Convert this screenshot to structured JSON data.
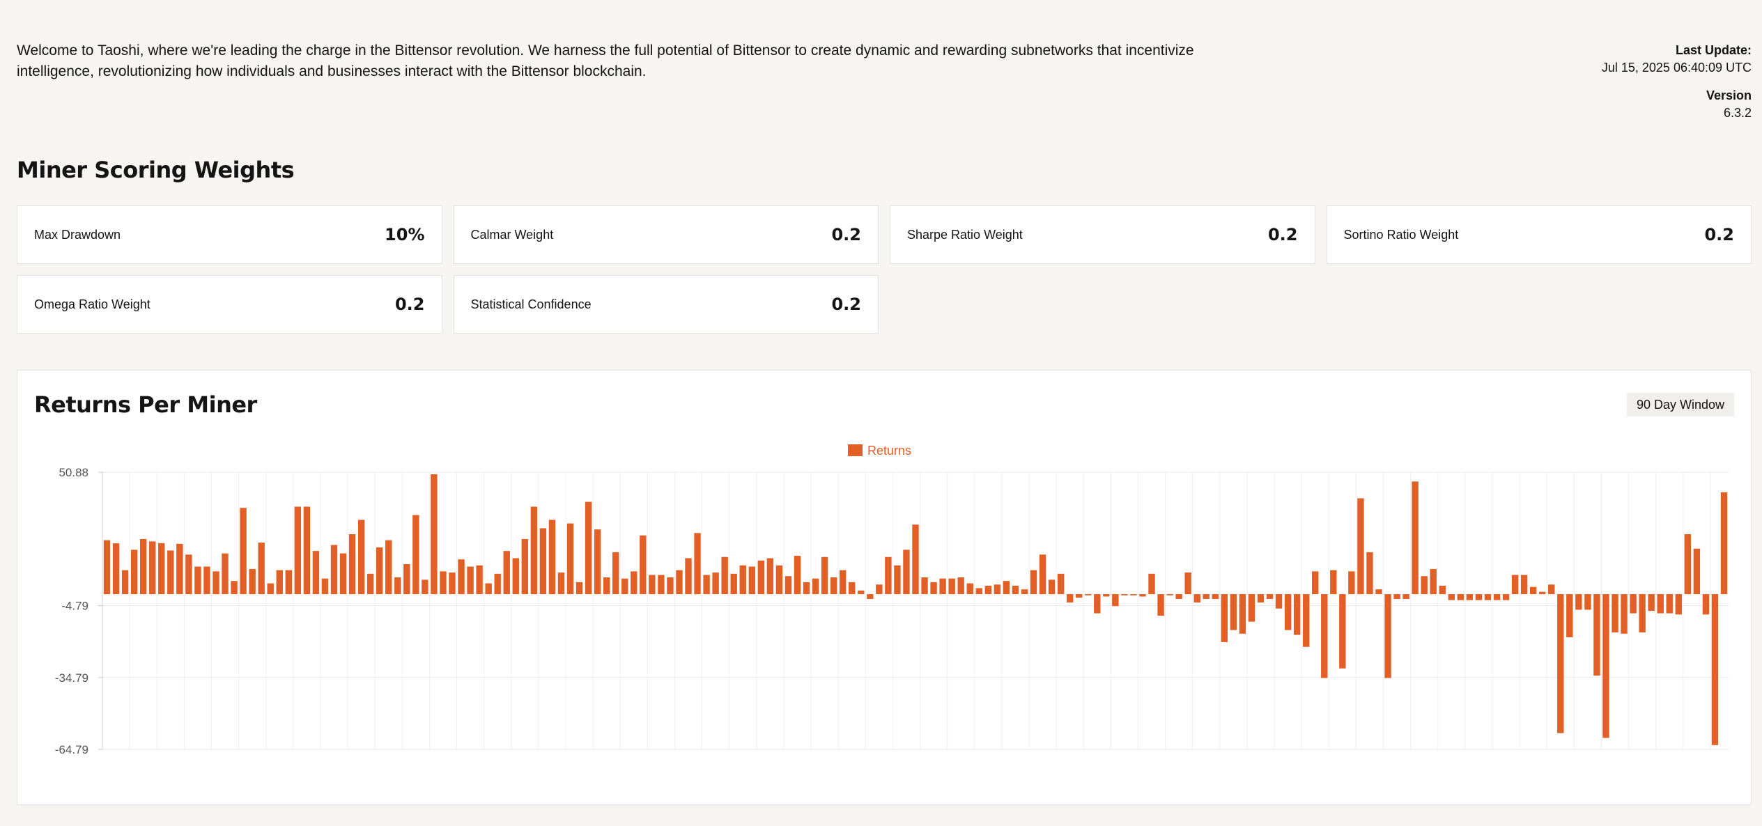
{
  "intro": "Welcome to Taoshi, where we're leading the charge in the Bittensor revolution. We harness the full potential of Bittensor to create dynamic and rewarding subnetworks that incentivize intelligence, revolutionizing how individuals and businesses interact with the Bittensor blockchain.",
  "meta": {
    "last_update_label": "Last Update:",
    "last_update_value": "Jul 15, 2025 06:40:09 UTC",
    "version_label": "Version",
    "version_value": "6.3.2"
  },
  "weights": {
    "title": "Miner Scoring Weights",
    "items": [
      {
        "label": "Max Drawdown",
        "value": "10%"
      },
      {
        "label": "Calmar Weight",
        "value": "0.2"
      },
      {
        "label": "Sharpe Ratio Weight",
        "value": "0.2"
      },
      {
        "label": "Sortino Ratio Weight",
        "value": "0.2"
      },
      {
        "label": "Omega Ratio Weight",
        "value": "0.2"
      },
      {
        "label": "Statistical Confidence",
        "value": "0.2"
      }
    ]
  },
  "returns_chart": {
    "title": "Returns Per Miner",
    "window_label": "90 Day Window"
  },
  "colors": {
    "bar": "#e25f26",
    "legend_text": "#e25f26"
  },
  "chart_data": {
    "type": "bar",
    "title": "Returns Per Miner",
    "xlabel": "",
    "ylabel": "",
    "ylim": [
      -64.79,
      50.88
    ],
    "y_ticks": [
      "50.88",
      "-4.79",
      "-34.79",
      "-64.79"
    ],
    "grid": true,
    "legend_position": "top-center",
    "series": [
      {
        "name": "Returns",
        "values": [
          22.5,
          21.2,
          10.0,
          18.5,
          23.0,
          22.0,
          21.3,
          18.2,
          21.0,
          16.5,
          11.5,
          11.5,
          9.5,
          17.0,
          5.5,
          36.0,
          10.5,
          21.5,
          4.5,
          10.0,
          10.0,
          36.5,
          36.5,
          18.0,
          6.5,
          20.5,
          17.0,
          25.0,
          31.0,
          8.5,
          19.5,
          22.5,
          7.0,
          12.5,
          33.0,
          6.0,
          50.0,
          9.5,
          9.0,
          14.5,
          11.5,
          12.0,
          4.5,
          8.5,
          18.0,
          15.0,
          23.0,
          36.5,
          27.5,
          31.0,
          9.0,
          29.5,
          5.0,
          38.5,
          27.0,
          7.0,
          17.5,
          6.5,
          9.5,
          24.5,
          8.0,
          8.0,
          7.0,
          10.0,
          15.0,
          25.5,
          8.0,
          9.0,
          15.5,
          8.5,
          12.0,
          11.5,
          14.0,
          15.0,
          12.0,
          7.5,
          16.0,
          5.0,
          6.5,
          15.5,
          7.0,
          10.0,
          5.0,
          1.5,
          -2.0,
          4.0,
          15.5,
          12.0,
          18.5,
          29.0,
          7.0,
          5.0,
          6.5,
          6.5,
          7.0,
          4.5,
          2.5,
          3.5,
          4.0,
          5.5,
          3.5,
          2.0,
          10.0,
          16.5,
          6.0,
          8.5,
          -3.5,
          -1.5,
          -0.5,
          -8.0,
          -1.0,
          -5.0,
          -0.5,
          -0.5,
          -1.0,
          8.5,
          -9.0,
          -0.5,
          -2.0,
          9.0,
          -3.5,
          -2.0,
          -2.0,
          -20.0,
          -15.0,
          -16.5,
          -11.5,
          -3.5,
          -2.0,
          -6.0,
          -15.0,
          -17.0,
          -22.0,
          9.5,
          -35.0,
          10.0,
          -31.0,
          9.5,
          40.0,
          17.5,
          2.0,
          -35.0,
          -2.0,
          -2.0,
          47.0,
          7.5,
          10.5,
          3.5,
          -2.5,
          -2.5,
          -2.5,
          -2.5,
          -2.5,
          -2.5,
          -2.5,
          8.0,
          8.0,
          3.0,
          1.0,
          4.0,
          -58.0,
          -18.0,
          -6.5,
          -6.5,
          -34.0,
          -60.0,
          -16.0,
          -16.5,
          -8.0,
          -16.0,
          -7.0,
          -8.0,
          -8.0,
          -8.5,
          25.0,
          19.0,
          -8.5,
          -63.0,
          42.5
        ]
      }
    ]
  }
}
